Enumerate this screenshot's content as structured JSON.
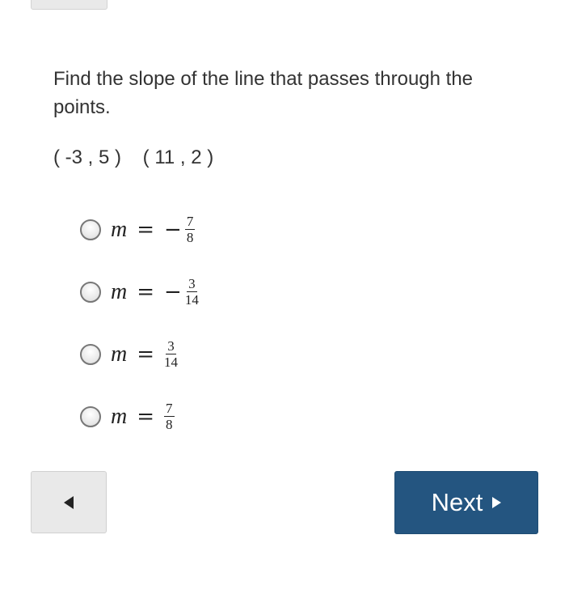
{
  "question": {
    "text": "Find the slope of the line that passes through the points.",
    "points": "( -3 , 5 )    ( 11 , 2 )"
  },
  "options": [
    {
      "variable": "m",
      "equals": "=",
      "sign": "−",
      "numerator": "7",
      "denominator": "8",
      "selected": false
    },
    {
      "variable": "m",
      "equals": "=",
      "sign": "−",
      "numerator": "3",
      "denominator": "14",
      "selected": false
    },
    {
      "variable": "m",
      "equals": "=",
      "sign": "",
      "numerator": "3",
      "denominator": "14",
      "selected": false
    },
    {
      "variable": "m",
      "equals": "=",
      "sign": "",
      "numerator": "7",
      "denominator": "8",
      "selected": false
    }
  ],
  "navigation": {
    "prev_icon": "triangle-left-icon",
    "next_label": "Next",
    "next_icon": "triangle-right-icon",
    "next_color": "#245580"
  }
}
